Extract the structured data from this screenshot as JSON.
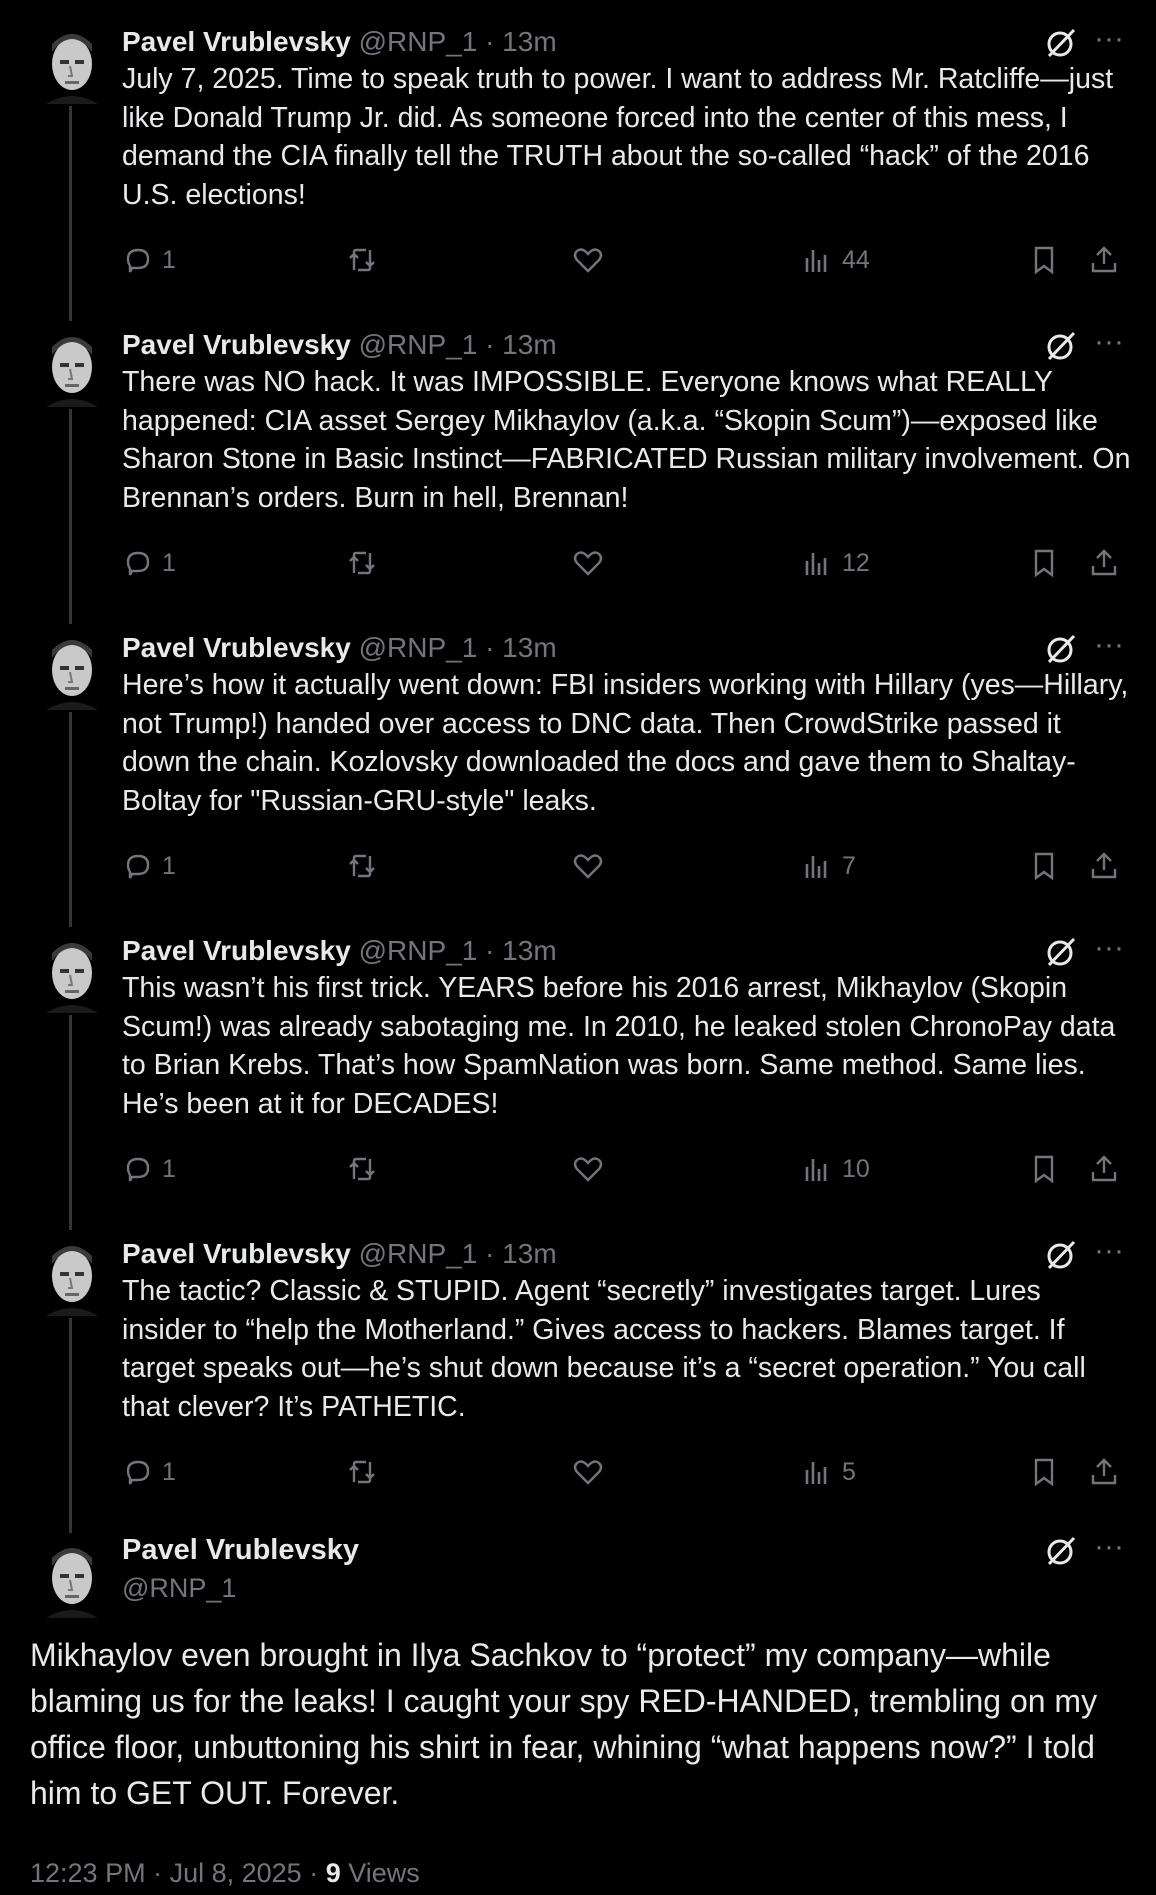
{
  "tweets": [
    {
      "name": "Pavel Vrublevsky",
      "handle": "@RNP_1",
      "time": "· 13m",
      "text": "July 7, 2025. Time to speak truth to power. I want to address Mr. Ratcliffe—just like Donald Trump Jr. did. As someone forced into the center of this mess, I demand the CIA finally tell the TRUTH about the so-called “hack” of the 2016 U.S. elections!",
      "replies": "1",
      "views": "44"
    },
    {
      "name": "Pavel Vrublevsky",
      "handle": "@RNP_1",
      "time": "· 13m",
      "text": "There was NO hack. It was IMPOSSIBLE. Everyone knows what REALLY happened: CIA asset Sergey Mikhaylov (a.k.a. “Skopin Scum”)—exposed like Sharon Stone in Basic Instinct—FABRICATED Russian military involvement. On Brennan’s orders. Burn in hell, Brennan!",
      "replies": "1",
      "views": "12"
    },
    {
      "name": "Pavel Vrublevsky",
      "handle": "@RNP_1",
      "time": "· 13m",
      "text": "Here’s how it actually went down: FBI insiders working with Hillary (yes—Hillary, not Trump!) handed over access to DNC data. Then CrowdStrike passed it down the chain. Kozlovsky downloaded the docs and gave them to Shaltay-Boltay for \"Russian-GRU-style\" leaks.",
      "replies": "1",
      "views": "7"
    },
    {
      "name": "Pavel Vrublevsky",
      "handle": "@RNP_1",
      "time": "· 13m",
      "text": "This wasn’t his first trick. YEARS before his 2016 arrest, Mikhaylov (Skopin Scum!) was already sabotaging me. In 2010, he leaked stolen ChronoPay data to Brian Krebs. That’s how SpamNation was born. Same method. Same lies. He’s been at it for DECADES!",
      "replies": "1",
      "views": "10"
    },
    {
      "name": "Pavel Vrublevsky",
      "handle": "@RNP_1",
      "time": "· 13m",
      "text": "The tactic? Classic & STUPID. Agent “secretly” investigates target. Lures insider to “help the Motherland.” Gives access to hackers. Blames target. If target speaks out—he’s shut down because it’s a “secret operation.” You call that clever? It’s PATHETIC.",
      "replies": "1",
      "views": "5"
    }
  ],
  "main_tweet": {
    "name": "Pavel Vrublevsky",
    "handle": "@RNP_1",
    "text": "Mikhaylov even brought in Ilya Sachkov to “protect” my company—while blaming us for the leaks! I caught your spy RED-HANDED, trembling on my office floor, unbuttoning his shirt in fear, whining “what happens now?” I told him to GET OUT. Forever.",
    "time": "12:23 PM",
    "date": "Jul 8, 2025",
    "views_count": "9",
    "views_label": "Views"
  },
  "ui": {
    "more_glyph": "···",
    "separator": " · "
  },
  "colors": {
    "background": "#000000",
    "text": "#e7e9ea",
    "muted": "#71767b",
    "line": "#333639"
  }
}
